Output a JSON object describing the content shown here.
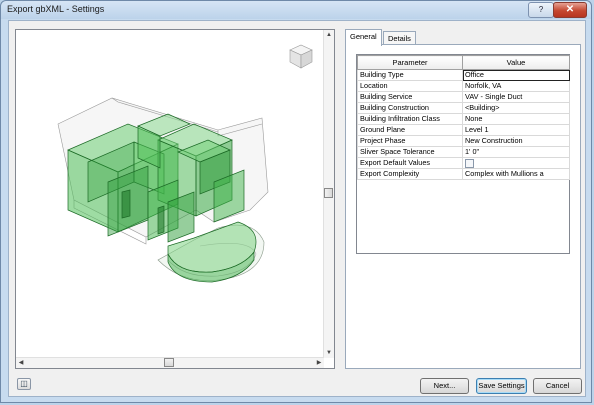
{
  "window": {
    "title": "Export gbXML - Settings",
    "help_label": "?",
    "close_label": "✕"
  },
  "tabs": [
    {
      "label": "General"
    },
    {
      "label": "Details"
    }
  ],
  "grid": {
    "headers": {
      "parameter": "Parameter",
      "value": "Value"
    },
    "rows": [
      {
        "parameter": "Building Type",
        "value": "Office"
      },
      {
        "parameter": "Location",
        "value": "Norfolk, VA"
      },
      {
        "parameter": "Building Service",
        "value": "VAV - Single Duct"
      },
      {
        "parameter": "Building Construction",
        "value": "<Building>"
      },
      {
        "parameter": "Building Infiltration Class",
        "value": "None"
      },
      {
        "parameter": "Ground Plane",
        "value": "Level 1"
      },
      {
        "parameter": "Project Phase",
        "value": "New Construction"
      },
      {
        "parameter": "Sliver Space Tolerance",
        "value": "1'  0\""
      },
      {
        "parameter": "Export Default Values",
        "value": ""
      },
      {
        "parameter": "Export Complexity",
        "value": "Complex with Mullions a"
      }
    ]
  },
  "buttons": {
    "next": "Next...",
    "save": "Save Settings",
    "cancel": "Cancel"
  },
  "icons": {
    "viewcube": "viewcube-icon",
    "preview_options": "camera-icon",
    "help": "help-icon",
    "close": "close-icon"
  },
  "colors": {
    "model_green": "#3fb44a",
    "title_gradient": "#bcd3ea",
    "close_red": "#c54730"
  }
}
